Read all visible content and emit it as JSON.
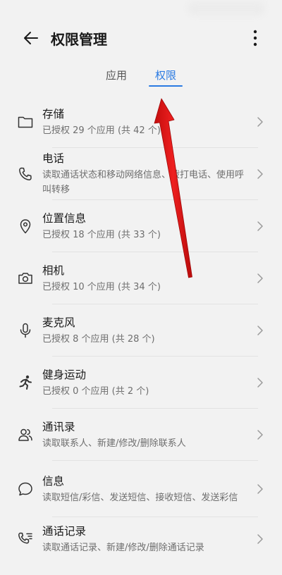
{
  "header": {
    "title": "权限管理"
  },
  "tabs": [
    {
      "label": "应用",
      "active": false
    },
    {
      "label": "权限",
      "active": true
    }
  ],
  "permissions": [
    {
      "icon": "folder-icon",
      "name": "存储",
      "desc": "已授权 29 个应用 (共 42 个)"
    },
    {
      "icon": "phone-icon",
      "name": "电话",
      "desc": "读取通话状态和移动网络信息、拨打电话、使用呼叫转移"
    },
    {
      "icon": "location-icon",
      "name": "位置信息",
      "desc": "已授权 18 个应用 (共 33 个)"
    },
    {
      "icon": "camera-icon",
      "name": "相机",
      "desc": "已授权 10 个应用 (共 34 个)"
    },
    {
      "icon": "microphone-icon",
      "name": "麦克风",
      "desc": "已授权 8 个应用 (共 28 个)"
    },
    {
      "icon": "running-icon",
      "name": "健身运动",
      "desc": "已授权 0 个应用 (共 2 个)"
    },
    {
      "icon": "contacts-icon",
      "name": "通讯录",
      "desc": "读取联系人、新建/修改/删除联系人"
    },
    {
      "icon": "message-icon",
      "name": "信息",
      "desc": "读取短信/彩信、发送短信、接收短信、发送彩信"
    },
    {
      "icon": "call-log-icon",
      "name": "通话记录",
      "desc": "读取通话记录、新建/修改/删除通话记录"
    }
  ],
  "colors": {
    "accent": "#2a7ae2",
    "annotation_arrow": "#e01818"
  }
}
